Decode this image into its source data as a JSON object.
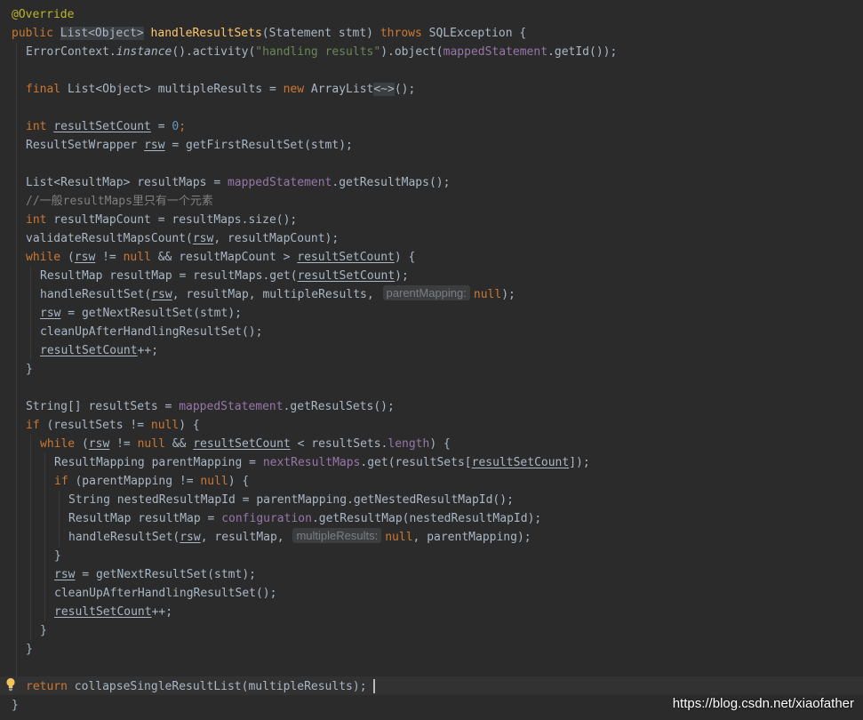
{
  "annotation": "@Override",
  "sig": {
    "mod": "public",
    "ret": "List<Object>",
    "name": "handleResultSets",
    "params": "(Statement stmt)",
    "throws": "throws",
    "exc": "SQLException {"
  },
  "l3": {
    "a": "ErrorContext.",
    "b": "instance",
    "c": "().activity(",
    "d": "\"handling results\"",
    "e": ").object(",
    "f": "mappedStatement",
    "g": ".getId());"
  },
  "l5": {
    "a": "final",
    "b": " List<Object> multipleResults = ",
    "c": "new",
    "d": " ArrayList",
    "e": "<~>",
    "f": "();"
  },
  "l7": {
    "a": "int",
    "b": " ",
    "c": "resultSetCount",
    "d": " = ",
    "e": "0",
    "f": ";"
  },
  "l8": {
    "a": "ResultSetWrapper ",
    "b": "rsw",
    "c": " = getFirstResultSet(stmt);"
  },
  "l10": {
    "a": "List<ResultMap> resultMaps = ",
    "b": "mappedStatement",
    "c": ".getResultMaps();"
  },
  "l11": {
    "a": "//一般resultMaps里只有一个元素"
  },
  "l12": {
    "a": "int",
    "b": " resultMapCount = resultMaps.size();"
  },
  "l13": {
    "a": "validateResultMapsCount(",
    "b": "rsw",
    "c": ", resultMapCount);"
  },
  "l14": {
    "a": "while",
    "b": " (",
    "c": "rsw",
    "d": " != ",
    "e": "null",
    "f": " && resultMapCount > ",
    "g": "resultSetCount",
    "h": ") {"
  },
  "l15": {
    "a": "ResultMap resultMap = resultMaps.get(",
    "b": "resultSetCount",
    "c": ");"
  },
  "l16": {
    "a": "handleResultSet(",
    "b": "rsw",
    "c": ", resultMap, multipleResults,",
    "hint": "parentMapping:",
    "d": "null",
    "e": ");"
  },
  "l17": {
    "a": "rsw",
    "b": " = getNextResultSet(stmt);"
  },
  "l18": {
    "a": "cleanUpAfterHandlingResultSet();"
  },
  "l19": {
    "a": "resultSetCount",
    "b": "++;"
  },
  "l20": {
    "a": "}"
  },
  "l22": {
    "a": "String[] resultSets = ",
    "b": "mappedStatement",
    "c": ".getResulSets();"
  },
  "l23": {
    "a": "if",
    "b": " (resultSets != ",
    "c": "null",
    "d": ") {"
  },
  "l24": {
    "a": "while",
    "b": " (",
    "c": "rsw",
    "d": " != ",
    "e": "null",
    "f": " && ",
    "g": "resultSetCount",
    "h": " < resultSets.",
    "i": "length",
    "j": ") {"
  },
  "l25": {
    "a": "ResultMapping parentMapping = ",
    "b": "nextResultMaps",
    "c": ".get(resultSets[",
    "d": "resultSetCount",
    "e": "]);"
  },
  "l26": {
    "a": "if",
    "b": " (parentMapping != ",
    "c": "null",
    "d": ") {"
  },
  "l27": {
    "a": "String nestedResultMapId = parentMapping.getNestedResultMapId();"
  },
  "l28": {
    "a": "ResultMap resultMap = ",
    "b": "configuration",
    "c": ".getResultMap(nestedResultMapId);"
  },
  "l29": {
    "a": "handleResultSet(",
    "b": "rsw",
    "c": ", resultMap,",
    "hint": "multipleResults:",
    "d": "null",
    "e": ", parentMapping);"
  },
  "l30": {
    "a": "}"
  },
  "l31": {
    "a": "rsw",
    "b": " = getNextResultSet(stmt);"
  },
  "l32": {
    "a": "cleanUpAfterHandlingResultSet();"
  },
  "l33": {
    "a": "resultSetCount",
    "b": "++;"
  },
  "l34": {
    "a": "}"
  },
  "l35": {
    "a": "}"
  },
  "l37": {
    "a": "return",
    "b": " collapseSingleResultList(multipleResults);"
  },
  "l38": {
    "a": "}"
  },
  "watermark": "https://blog.csdn.net/xiaofather",
  "colors": {
    "background": "#2b2b2b",
    "keyword": "#cc7832",
    "annotation": "#bbb529",
    "string": "#6a8759",
    "number": "#6897bb",
    "field": "#9876aa",
    "method_decl": "#ffc66d",
    "comment": "#808080",
    "default_text": "#a9b7c6"
  },
  "icons": {
    "bulb": "lightbulb-icon"
  }
}
